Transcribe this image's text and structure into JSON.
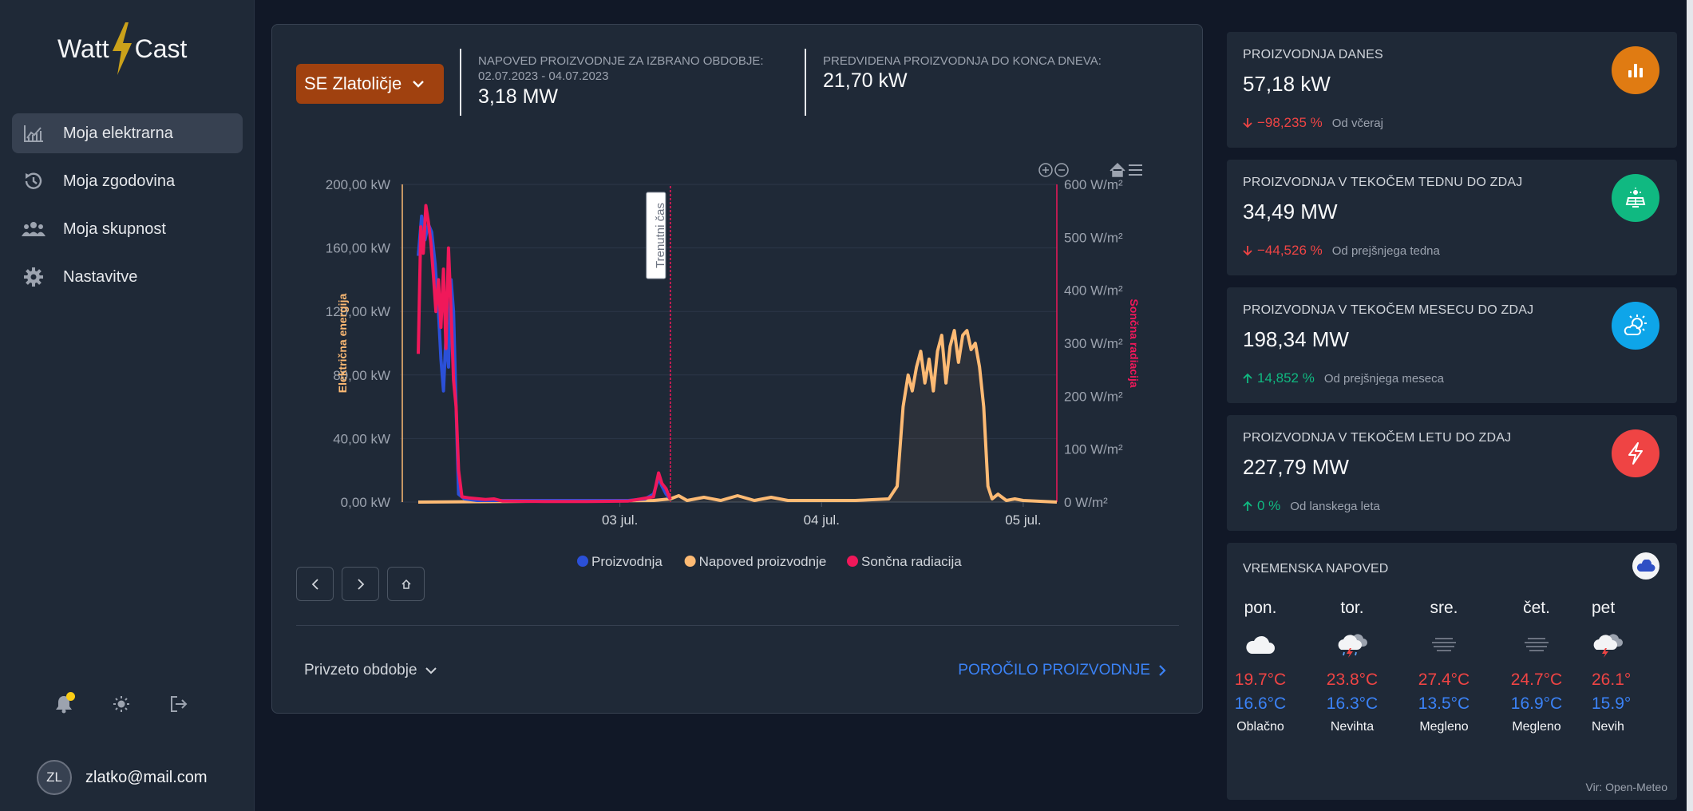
{
  "app": {
    "logo_left": "Watt",
    "logo_right": "Cast"
  },
  "nav": {
    "items": [
      {
        "label": "Moja elektrarna",
        "icon": "chart-line-icon",
        "active": true
      },
      {
        "label": "Moja zgodovina",
        "icon": "history-icon",
        "active": false
      },
      {
        "label": "Moja skupnost",
        "icon": "community-icon",
        "active": false
      },
      {
        "label": "Nastavitve",
        "icon": "gear-icon",
        "active": false
      }
    ]
  },
  "user": {
    "initials": "ZL",
    "email": "zlatko@mail.com"
  },
  "header": {
    "plant": "SE Zlatoličje",
    "forecast_label_1": "NAPOVED PROIZVODNJE ZA IZBRANO OBDOBJE:",
    "forecast_label_2": "02.07.2023 - 04.07.2023",
    "forecast_value": "3,18 MW",
    "expected_label": "PREDVIDENA PROIZVODNJA DO KONCA DNEVA:",
    "expected_value": "21,70 kW"
  },
  "chart_data": {
    "type": "line",
    "x_ticks": [
      "03 jul.",
      "04 jul.",
      "05 jul."
    ],
    "left_axis": {
      "label": "Električna energija",
      "ticks": [
        "0,00 kW",
        "40,00 kW",
        "80,00 kW",
        "120,00 kW",
        "160,00 kW",
        "200,00 kW"
      ],
      "range": [
        0,
        200
      ]
    },
    "right_axis": {
      "label": "Sončna radiacija",
      "ticks": [
        "0 W/m²",
        "100 W/m²",
        "200 W/m²",
        "300 W/m²",
        "400 W/m²",
        "500 W/m²",
        "600 W/m²"
      ],
      "range": [
        0,
        600
      ]
    },
    "x_range_hours": [
      -20,
      56
    ],
    "current_time_label": "Trenutni čas",
    "current_time_hour": 10,
    "series": [
      {
        "name": "Proizvodnja",
        "color": "#2b50d8",
        "axis": "left",
        "points": [
          [
            -20,
            155
          ],
          [
            -19.6,
            180
          ],
          [
            -19.2,
            165
          ],
          [
            -18.8,
            175
          ],
          [
            -18.4,
            170
          ],
          [
            -18,
            150
          ],
          [
            -17.6,
            120
          ],
          [
            -17.3,
            90
          ],
          [
            -17,
            70
          ],
          [
            -16.7,
            105
          ],
          [
            -16.4,
            85
          ],
          [
            -16.1,
            140
          ],
          [
            -15.8,
            120
          ],
          [
            -15.5,
            60
          ],
          [
            -15.2,
            5
          ],
          [
            -14.5,
            2
          ],
          [
            -13,
            1
          ],
          [
            -10,
            1
          ],
          [
            -5,
            1
          ],
          [
            0,
            1
          ],
          [
            5,
            1
          ],
          [
            7,
            2
          ],
          [
            8,
            5
          ],
          [
            8.6,
            15
          ],
          [
            9,
            10
          ],
          [
            9.5,
            5
          ],
          [
            10,
            2
          ]
        ]
      },
      {
        "name": "Napoved proizvodnje",
        "color": "#fdba74",
        "axis": "left",
        "points": [
          [
            -20,
            0
          ],
          [
            8,
            1
          ],
          [
            10,
            2
          ],
          [
            11,
            4
          ],
          [
            12,
            1
          ],
          [
            14,
            3
          ],
          [
            16,
            1
          ],
          [
            18,
            4
          ],
          [
            20,
            1
          ],
          [
            22,
            3
          ],
          [
            24,
            1
          ],
          [
            28,
            1
          ],
          [
            32,
            1
          ],
          [
            36,
            2
          ],
          [
            37,
            10
          ],
          [
            37.7,
            60
          ],
          [
            38.3,
            80
          ],
          [
            38.8,
            70
          ],
          [
            39.3,
            85
          ],
          [
            39.8,
            95
          ],
          [
            40.3,
            75
          ],
          [
            40.8,
            90
          ],
          [
            41.3,
            70
          ],
          [
            41.8,
            95
          ],
          [
            42.3,
            105
          ],
          [
            42.8,
            75
          ],
          [
            43.3,
            98
          ],
          [
            43.8,
            108
          ],
          [
            44.3,
            88
          ],
          [
            44.8,
            105
          ],
          [
            45.3,
            108
          ],
          [
            45.8,
            96
          ],
          [
            46.3,
            100
          ],
          [
            46.8,
            85
          ],
          [
            47.3,
            60
          ],
          [
            47.8,
            10
          ],
          [
            48.3,
            2
          ],
          [
            49,
            5
          ],
          [
            50,
            1
          ],
          [
            51,
            2
          ],
          [
            52,
            1
          ],
          [
            56,
            0
          ]
        ]
      },
      {
        "name": "Sončna radiacija",
        "color": "#f0185a",
        "axis": "right",
        "points": [
          [
            -20,
            280
          ],
          [
            -19.7,
            520
          ],
          [
            -19.4,
            470
          ],
          [
            -19.1,
            560
          ],
          [
            -18.8,
            530
          ],
          [
            -18.5,
            490
          ],
          [
            -18.2,
            430
          ],
          [
            -17.9,
            360
          ],
          [
            -17.6,
            420
          ],
          [
            -17.3,
            330
          ],
          [
            -17,
            440
          ],
          [
            -16.7,
            290
          ],
          [
            -16.4,
            480
          ],
          [
            -16.1,
            360
          ],
          [
            -15.8,
            230
          ],
          [
            -15.5,
            180
          ],
          [
            -15.2,
            60
          ],
          [
            -14.8,
            10
          ],
          [
            -14,
            8
          ],
          [
            -12,
            5
          ],
          [
            -11,
            6
          ],
          [
            -10,
            2
          ],
          [
            -5,
            1
          ],
          [
            0,
            1
          ],
          [
            5,
            2
          ],
          [
            8,
            10
          ],
          [
            8.6,
            55
          ],
          [
            9,
            35
          ],
          [
            9.5,
            25
          ],
          [
            10,
            5
          ]
        ]
      }
    ]
  },
  "controls": {
    "period": "Privzeto obdobje",
    "report": "POROČILO PROIZVODNJE"
  },
  "stats": [
    {
      "title": "PROIZVODNJA DANES",
      "value": "57,18 kW",
      "change": "−98,235 %",
      "since": "Od včeraj",
      "trend": "down",
      "icon": "bar-chart-icon",
      "icon_color": "#e07b12"
    },
    {
      "title": "PROIZVODNJA V TEKOČEM TEDNU DO ZDAJ",
      "value": "34,49 MW",
      "change": "−44,526 %",
      "since": "Od prejšnjega tedna",
      "trend": "down",
      "icon": "solar-panel-icon",
      "icon_color": "#10b981"
    },
    {
      "title": "PROIZVODNJA V TEKOČEM MESECU DO ZDAJ",
      "value": "198,34 MW",
      "change": "14,852 %",
      "since": "Od prejšnjega meseca",
      "trend": "up",
      "icon": "sun-cloud-icon",
      "icon_color": "#0ea5e9"
    },
    {
      "title": "PROIZVODNJA V TEKOČEM LETU DO ZDAJ",
      "value": "227,79 MW",
      "change": "0 %",
      "since": "Od lanskega leta",
      "trend": "up",
      "icon": "lightning-icon",
      "icon_color": "#ef4444"
    }
  ],
  "weather": {
    "title": "VREMENSKA NAPOVED",
    "source": "Vir: Open-Meteo",
    "days": [
      {
        "name": "pon.",
        "max": "19.7°C",
        "min": "16.6°C",
        "desc": "Oblačno",
        "icon": "cloud-icon"
      },
      {
        "name": "tor.",
        "max": "23.8°C",
        "min": "16.3°C",
        "desc": "Nevihta",
        "icon": "storm-icon"
      },
      {
        "name": "sre.",
        "max": "27.4°C",
        "min": "13.5°C",
        "desc": "Megleno",
        "icon": "fog-icon"
      },
      {
        "name": "čet.",
        "max": "24.7°C",
        "min": "16.9°C",
        "desc": "Megleno",
        "icon": "fog-icon"
      },
      {
        "name": "pet",
        "max": "26.1°",
        "min": "15.9°",
        "desc": "Nevih",
        "icon": "storm-icon"
      }
    ]
  },
  "colors": {
    "background": "#111827",
    "panel": "#1f2937",
    "accent_orange": "#a0410f",
    "link_blue": "#3b82f6",
    "down_red": "#ef4444",
    "up_green": "#10b981"
  }
}
